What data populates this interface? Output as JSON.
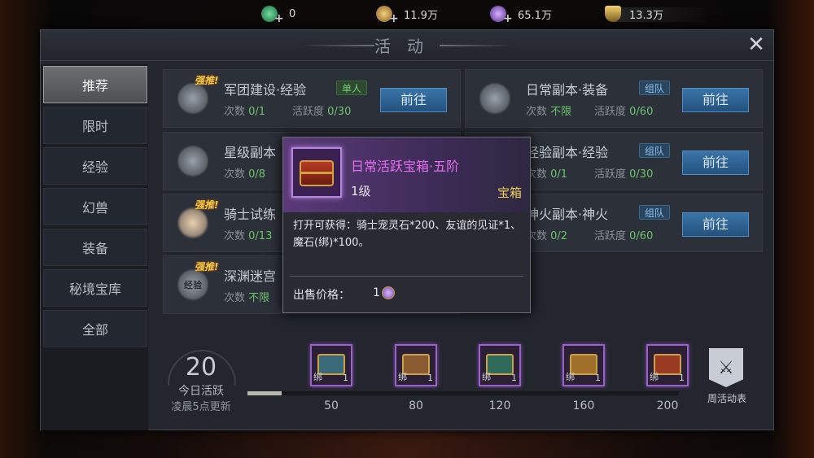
{
  "currencies": [
    {
      "icon": "jade-icon",
      "value": "0",
      "color": "#3fa56a"
    },
    {
      "icon": "gold-coin-icon",
      "value": "11.9万",
      "color": "#c9a04a"
    },
    {
      "icon": "magic-stone-icon",
      "value": "65.1万",
      "color": "#9b6fd6"
    },
    {
      "icon": "honor-shield-icon",
      "value": "13.3万",
      "color": "#d6b24a"
    }
  ],
  "panel": {
    "title": "活动",
    "close_icon": "close-icon"
  },
  "sidebar": {
    "items": [
      {
        "label": "推荐",
        "active": true
      },
      {
        "label": "限时",
        "active": false
      },
      {
        "label": "经验",
        "active": false
      },
      {
        "label": "幻兽",
        "active": false
      },
      {
        "label": "装备",
        "active": false
      },
      {
        "label": "秘境宝库",
        "active": false
      },
      {
        "label": "全部",
        "active": false
      }
    ]
  },
  "activities": [
    {
      "name": "军团建设·经验",
      "hot": "强推!",
      "tag": "单人",
      "tag_type": "single",
      "count_label": "次数",
      "count": "0/1",
      "vitality_label": "活跃度",
      "vitality": "0/30",
      "button": "前往"
    },
    {
      "name": "日常副本·装备",
      "hot": "",
      "tag": "组队",
      "tag_type": "team",
      "count_label": "次数",
      "count": "不限",
      "vitality_label": "活跃度",
      "vitality": "0/60",
      "button": "前往"
    },
    {
      "name": "星级副本",
      "hot": "",
      "tag": "",
      "tag_type": "",
      "count_label": "次数",
      "count": "0/8",
      "vitality_label": "",
      "vitality": "",
      "button": ""
    },
    {
      "name": "经验副本·经验",
      "hot": "",
      "tag": "组队",
      "tag_type": "team",
      "count_label": "次数",
      "count": "0/1",
      "vitality_label": "活跃度",
      "vitality": "0/30",
      "button": "前往"
    },
    {
      "name": "骑士试练",
      "hot": "强推!",
      "tag": "",
      "tag_type": "",
      "count_label": "次数",
      "count": "0/13",
      "vitality_label": "",
      "vitality": "",
      "button": ""
    },
    {
      "name": "神火副本·神火",
      "hot": "",
      "tag": "组队",
      "tag_type": "team",
      "count_label": "次数",
      "count": "0/2",
      "vitality_label": "活跃度",
      "vitality": "0/60",
      "button": "前往"
    },
    {
      "name": "深渊迷宫",
      "hot": "强推!",
      "icon_text": "经验",
      "tag": "",
      "tag_type": "",
      "count_label": "次数",
      "count": "不限",
      "vitality_label": "",
      "vitality": "",
      "button": ""
    }
  ],
  "tooltip": {
    "name": "日常活跃宝箱·五阶",
    "level": "1级",
    "type": "宝箱",
    "desc": "打开可获得：骑士宠灵石*200、友谊的见证*1、魔石(绑)*100。",
    "price_label": "出售价格：",
    "price": "1"
  },
  "progress": {
    "value": "20",
    "label": "今日活跃",
    "note": "凌晨5点更新",
    "fill_fraction": 0.08,
    "rewards": [
      {
        "milestone": "50",
        "bind": "绑",
        "qty": "1",
        "color": "#3a6a78"
      },
      {
        "milestone": "80",
        "bind": "绑",
        "qty": "1",
        "color": "#8a5a30"
      },
      {
        "milestone": "120",
        "bind": "绑",
        "qty": "1",
        "color": "#2f6a5a"
      },
      {
        "milestone": "160",
        "bind": "绑",
        "qty": "1",
        "color": "#a0702a"
      },
      {
        "milestone": "200",
        "bind": "绑",
        "qty": "1",
        "color": "#9a3a22"
      }
    ],
    "weekly_label": "周活动表"
  }
}
